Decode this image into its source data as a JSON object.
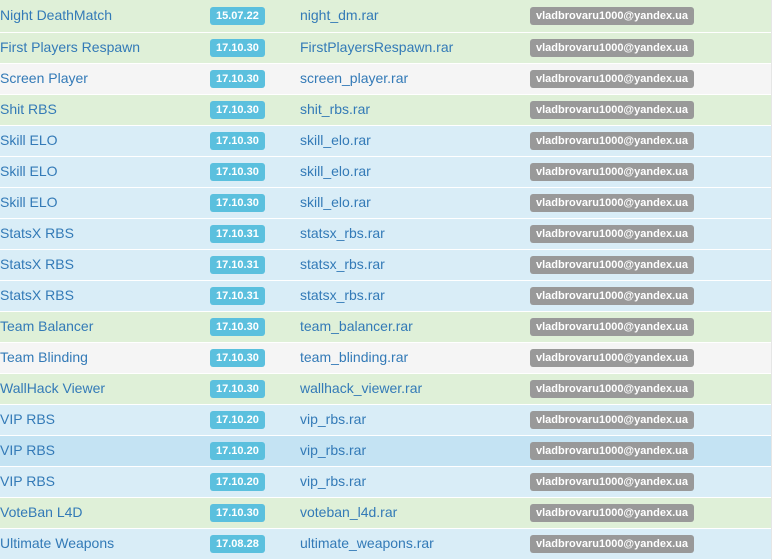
{
  "rows": [
    {
      "name": "Night DeathMatch",
      "version": "15.07.22",
      "file": "night_dm.rar",
      "author": "vladbrovaru1000@yandex.ua",
      "style": "success"
    },
    {
      "name": "First Players Respawn",
      "version": "17.10.30",
      "file": "FirstPlayersRespawn.rar",
      "author": "vladbrovaru1000@yandex.ua",
      "style": "success"
    },
    {
      "name": "Screen Player",
      "version": "17.10.30",
      "file": "screen_player.rar",
      "author": "vladbrovaru1000@yandex.ua",
      "style": "active"
    },
    {
      "name": "Shit RBS",
      "version": "17.10.30",
      "file": "shit_rbs.rar",
      "author": "vladbrovaru1000@yandex.ua",
      "style": "success"
    },
    {
      "name": "Skill ELO",
      "version": "17.10.30",
      "file": "skill_elo.rar",
      "author": "vladbrovaru1000@yandex.ua",
      "style": "info"
    },
    {
      "name": "Skill ELO",
      "version": "17.10.30",
      "file": "skill_elo.rar",
      "author": "vladbrovaru1000@yandex.ua",
      "style": "info"
    },
    {
      "name": "Skill ELO",
      "version": "17.10.30",
      "file": "skill_elo.rar",
      "author": "vladbrovaru1000@yandex.ua",
      "style": "info"
    },
    {
      "name": "StatsX RBS",
      "version": "17.10.31",
      "file": "statsx_rbs.rar",
      "author": "vladbrovaru1000@yandex.ua",
      "style": "info"
    },
    {
      "name": "StatsX RBS",
      "version": "17.10.31",
      "file": "statsx_rbs.rar",
      "author": "vladbrovaru1000@yandex.ua",
      "style": "info"
    },
    {
      "name": "StatsX RBS",
      "version": "17.10.31",
      "file": "statsx_rbs.rar",
      "author": "vladbrovaru1000@yandex.ua",
      "style": "info"
    },
    {
      "name": "Team Balancer",
      "version": "17.10.30",
      "file": "team_balancer.rar",
      "author": "vladbrovaru1000@yandex.ua",
      "style": "success"
    },
    {
      "name": "Team Blinding",
      "version": "17.10.30",
      "file": "team_blinding.rar",
      "author": "vladbrovaru1000@yandex.ua",
      "style": "active"
    },
    {
      "name": "WallHack Viewer",
      "version": "17.10.30",
      "file": "wallhack_viewer.rar",
      "author": "vladbrovaru1000@yandex.ua",
      "style": "success"
    },
    {
      "name": "VIP RBS",
      "version": "17.10.20",
      "file": "vip_rbs.rar",
      "author": "vladbrovaru1000@yandex.ua",
      "style": "info"
    },
    {
      "name": "VIP RBS",
      "version": "17.10.20",
      "file": "vip_rbs.rar",
      "author": "vladbrovaru1000@yandex.ua",
      "style": "hover"
    },
    {
      "name": "VIP RBS",
      "version": "17.10.20",
      "file": "vip_rbs.rar",
      "author": "vladbrovaru1000@yandex.ua",
      "style": "info"
    },
    {
      "name": "VoteBan L4D",
      "version": "17.10.30",
      "file": "voteban_l4d.rar",
      "author": "vladbrovaru1000@yandex.ua",
      "style": "success"
    },
    {
      "name": "Ultimate Weapons",
      "version": "17.08.28",
      "file": "ultimate_weapons.rar",
      "author": "vladbrovaru1000@yandex.ua",
      "style": "info"
    }
  ],
  "colors": {
    "link": "#337ab7",
    "version_badge": "#5bc0de",
    "author_badge": "#999999",
    "row_success": "#dff0d8",
    "row_info": "#d9edf7",
    "row_active": "#f5f5f5",
    "row_hover": "#c4e3f3"
  }
}
